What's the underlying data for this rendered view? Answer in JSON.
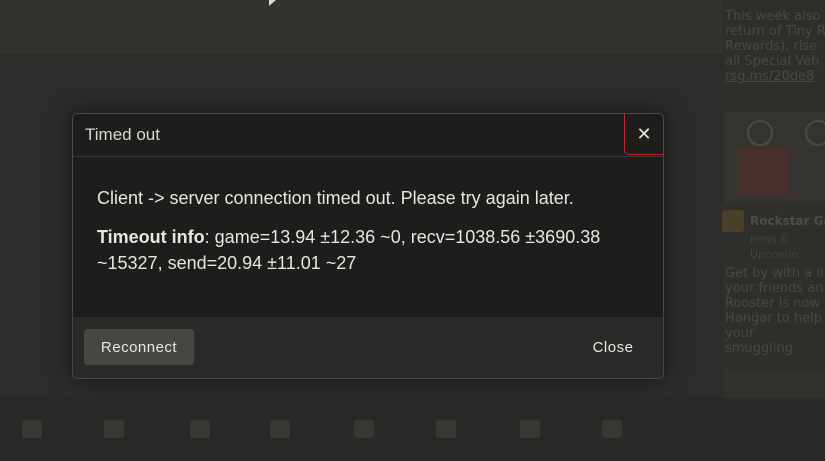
{
  "dialog": {
    "title": "Timed out",
    "close_icon": "close-icon",
    "close_glyph": "✕",
    "message": "Client -> server connection timed out. Please try again later.",
    "info_label": "Timeout info",
    "info_text": ": game=13.94 ±12.36 ~0, recv=1038.56 ±3690.38 ~15327, send=20.94 ±11.01 ~27",
    "buttons": {
      "reconnect": "Reconnect",
      "close": "Close"
    }
  },
  "background": {
    "feed": {
      "lines_top": [
        "This week also",
        "return of Tiny R",
        "Rewards), rise",
        "all Special Veh"
      ],
      "link": "rsg.ms/20de8",
      "author": "Rockstar Game",
      "author_sub": "Infos & Upcomin",
      "body_lines": [
        "Get by with a li",
        "your friends an",
        "Rooster is now",
        "Hangar to help",
        "your smuggling"
      ]
    }
  },
  "colors": {
    "accent_red": "#c0272c",
    "dialog_bg": "#1e1d1b",
    "footer_bg": "#2b2a28",
    "button_bg": "#474643"
  }
}
